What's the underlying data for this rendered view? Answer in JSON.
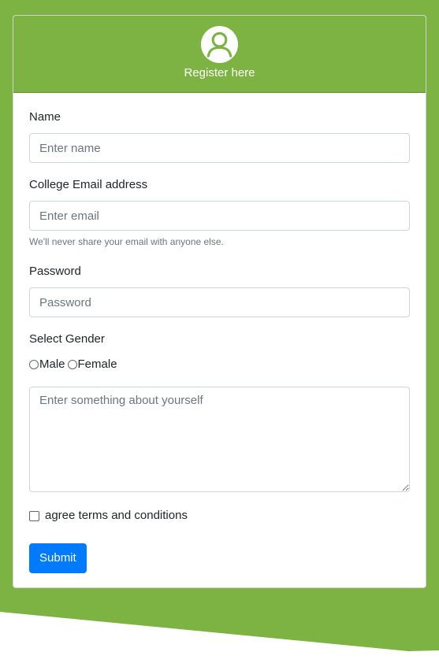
{
  "theme": {
    "brand_green": "#7db343",
    "primary_blue": "#007bff"
  },
  "header": {
    "icon": "user-avatar-icon",
    "title": "Register here"
  },
  "form": {
    "name": {
      "label": "Name",
      "placeholder": "Enter name",
      "value": ""
    },
    "email": {
      "label": "College Email address",
      "placeholder": "Enter email",
      "value": "",
      "hint": "We'll never share your email with anyone else."
    },
    "password": {
      "label": "Password",
      "placeholder": "Password",
      "value": ""
    },
    "gender": {
      "label": "Select Gender",
      "options": [
        "Male",
        "Female"
      ]
    },
    "about": {
      "placeholder": "Enter something about yourself",
      "value": ""
    },
    "terms": {
      "label": "agree terms and conditions",
      "checked": false
    },
    "submit_label": "Submit"
  }
}
